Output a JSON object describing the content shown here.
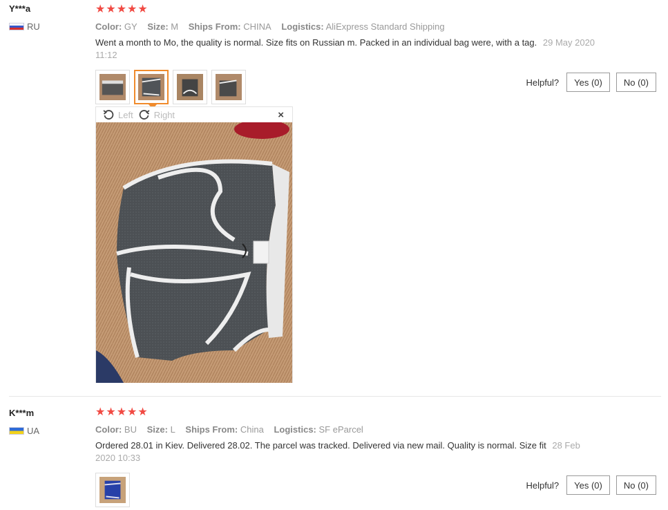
{
  "reviews": [
    {
      "username": "Y***a",
      "country": "RU",
      "stars": "★★★★★",
      "attributes": [
        {
          "key": "Color:",
          "value": "GY"
        },
        {
          "key": "Size:",
          "value": "M"
        },
        {
          "key": "Ships From:",
          "value": "CHINA"
        },
        {
          "key": "Logistics:",
          "value": "AliExpress Standard Shipping"
        }
      ],
      "text": "Went a month to Mo, the quality is normal. Size fits on Russian m. Packed in an individual bag were, with a tag.",
      "date": "29 May 2020 11:12",
      "helpful_label": "Helpful?",
      "yes_label": "Yes (0)",
      "no_label": "No (0)"
    },
    {
      "username": "K***m",
      "country": "UA",
      "stars": "★★★★★",
      "attributes": [
        {
          "key": "Color:",
          "value": "BU"
        },
        {
          "key": "Size:",
          "value": "L"
        },
        {
          "key": "Ships From:",
          "value": "China"
        },
        {
          "key": "Logistics:",
          "value": "SF eParcel"
        }
      ],
      "text": "Ordered 28.01 in Kiev. Delivered 28.02. The parcel was tracked. Delivered via new mail. Quality is normal. Size fit",
      "date": "28 Feb 2020 10:33",
      "helpful_label": "Helpful?",
      "yes_label": "Yes (0)",
      "no_label": "No (0)"
    }
  ],
  "viewer": {
    "rotate_left_label": "Left",
    "rotate_right_label": "Right",
    "close_label": "×"
  },
  "colors": {
    "star": "#f14a43",
    "active_thumb": "#f08b2c"
  }
}
